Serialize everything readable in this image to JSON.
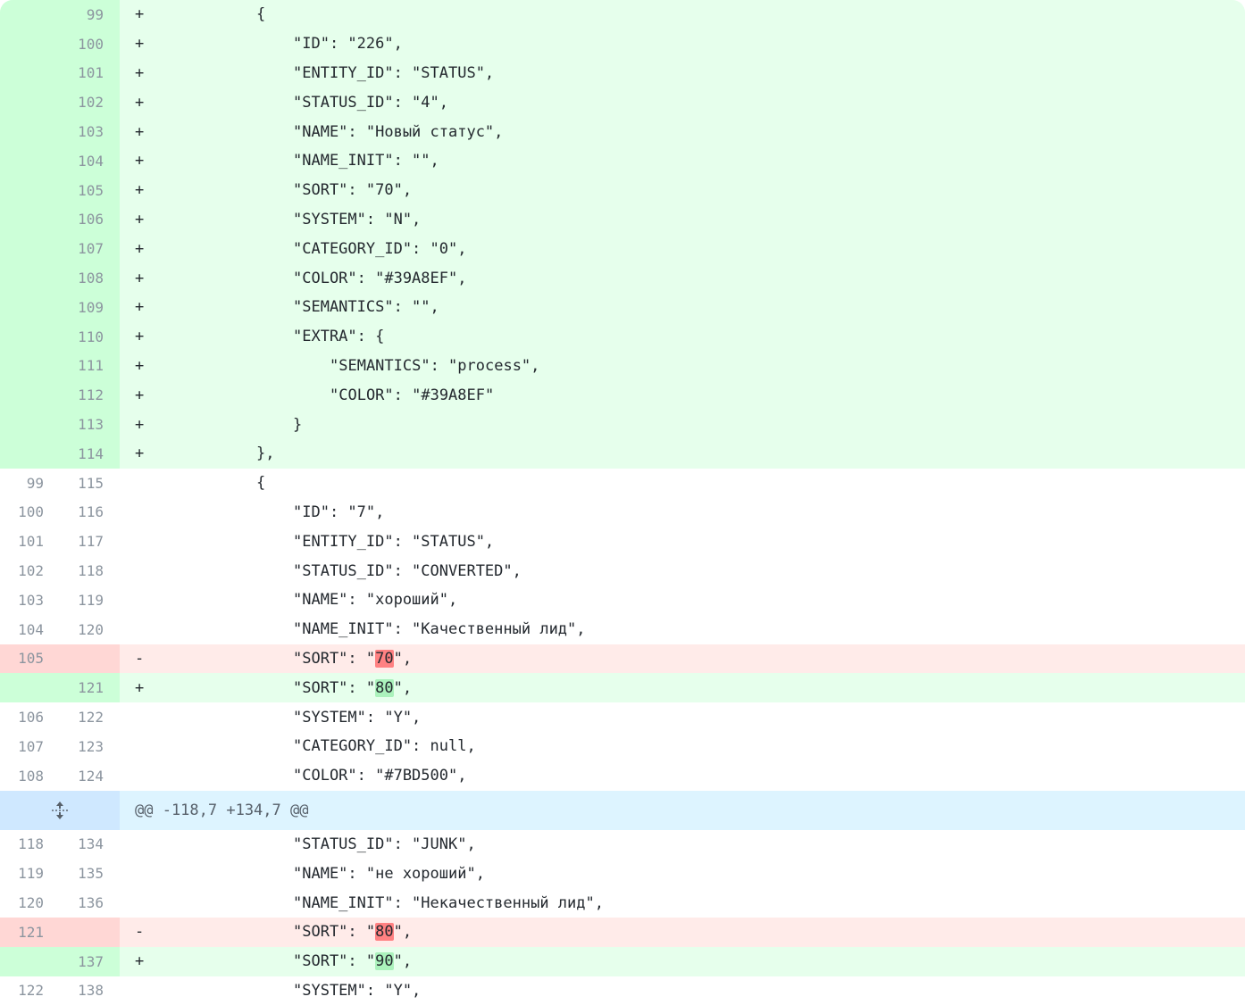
{
  "diff": {
    "block1": [
      {
        "type": "add",
        "old": "",
        "new": "99",
        "sign": "+",
        "indent": 6,
        "pre": "{",
        "hl": "",
        "post": ""
      },
      {
        "type": "add",
        "old": "",
        "new": "100",
        "sign": "+",
        "indent": 8,
        "pre": "\"ID\": \"226\",",
        "hl": "",
        "post": ""
      },
      {
        "type": "add",
        "old": "",
        "new": "101",
        "sign": "+",
        "indent": 8,
        "pre": "\"ENTITY_ID\": \"STATUS\",",
        "hl": "",
        "post": ""
      },
      {
        "type": "add",
        "old": "",
        "new": "102",
        "sign": "+",
        "indent": 8,
        "pre": "\"STATUS_ID\": \"4\",",
        "hl": "",
        "post": ""
      },
      {
        "type": "add",
        "old": "",
        "new": "103",
        "sign": "+",
        "indent": 8,
        "pre": "\"NAME\": \"Новый статус\",",
        "hl": "",
        "post": ""
      },
      {
        "type": "add",
        "old": "",
        "new": "104",
        "sign": "+",
        "indent": 8,
        "pre": "\"NAME_INIT\": \"\",",
        "hl": "",
        "post": ""
      },
      {
        "type": "add",
        "old": "",
        "new": "105",
        "sign": "+",
        "indent": 8,
        "pre": "\"SORT\": \"70\",",
        "hl": "",
        "post": ""
      },
      {
        "type": "add",
        "old": "",
        "new": "106",
        "sign": "+",
        "indent": 8,
        "pre": "\"SYSTEM\": \"N\",",
        "hl": "",
        "post": ""
      },
      {
        "type": "add",
        "old": "",
        "new": "107",
        "sign": "+",
        "indent": 8,
        "pre": "\"CATEGORY_ID\": \"0\",",
        "hl": "",
        "post": ""
      },
      {
        "type": "add",
        "old": "",
        "new": "108",
        "sign": "+",
        "indent": 8,
        "pre": "\"COLOR\": \"#39A8EF\",",
        "hl": "",
        "post": ""
      },
      {
        "type": "add",
        "old": "",
        "new": "109",
        "sign": "+",
        "indent": 8,
        "pre": "\"SEMANTICS\": \"\",",
        "hl": "",
        "post": ""
      },
      {
        "type": "add",
        "old": "",
        "new": "110",
        "sign": "+",
        "indent": 8,
        "pre": "\"EXTRA\": {",
        "hl": "",
        "post": ""
      },
      {
        "type": "add",
        "old": "",
        "new": "111",
        "sign": "+",
        "indent": 10,
        "pre": "\"SEMANTICS\": \"process\",",
        "hl": "",
        "post": ""
      },
      {
        "type": "add",
        "old": "",
        "new": "112",
        "sign": "+",
        "indent": 10,
        "pre": "\"COLOR\": \"#39A8EF\"",
        "hl": "",
        "post": ""
      },
      {
        "type": "add",
        "old": "",
        "new": "113",
        "sign": "+",
        "indent": 8,
        "pre": "}",
        "hl": "",
        "post": ""
      },
      {
        "type": "add",
        "old": "",
        "new": "114",
        "sign": "+",
        "indent": 6,
        "pre": "},",
        "hl": "",
        "post": ""
      },
      {
        "type": "ctx",
        "old": "99",
        "new": "115",
        "sign": "",
        "indent": 6,
        "pre": "{",
        "hl": "",
        "post": ""
      },
      {
        "type": "ctx",
        "old": "100",
        "new": "116",
        "sign": "",
        "indent": 8,
        "pre": "\"ID\": \"7\",",
        "hl": "",
        "post": ""
      },
      {
        "type": "ctx",
        "old": "101",
        "new": "117",
        "sign": "",
        "indent": 8,
        "pre": "\"ENTITY_ID\": \"STATUS\",",
        "hl": "",
        "post": ""
      },
      {
        "type": "ctx",
        "old": "102",
        "new": "118",
        "sign": "",
        "indent": 8,
        "pre": "\"STATUS_ID\": \"CONVERTED\",",
        "hl": "",
        "post": ""
      },
      {
        "type": "ctx",
        "old": "103",
        "new": "119",
        "sign": "",
        "indent": 8,
        "pre": "\"NAME\": \"хороший\",",
        "hl": "",
        "post": ""
      },
      {
        "type": "ctx",
        "old": "104",
        "new": "120",
        "sign": "",
        "indent": 8,
        "pre": "\"NAME_INIT\": \"Качественный лид\",",
        "hl": "",
        "post": ""
      },
      {
        "type": "del",
        "old": "105",
        "new": "",
        "sign": "-",
        "indent": 8,
        "pre": "\"SORT\": \"",
        "hl": "70",
        "post": "\","
      },
      {
        "type": "add",
        "old": "",
        "new": "121",
        "sign": "+",
        "indent": 8,
        "pre": "\"SORT\": \"",
        "hl": "80",
        "post": "\","
      },
      {
        "type": "ctx",
        "old": "106",
        "new": "122",
        "sign": "",
        "indent": 8,
        "pre": "\"SYSTEM\": \"Y\",",
        "hl": "",
        "post": ""
      },
      {
        "type": "ctx",
        "old": "107",
        "new": "123",
        "sign": "",
        "indent": 8,
        "pre": "\"CATEGORY_ID\": null,",
        "hl": "",
        "post": ""
      },
      {
        "type": "ctx",
        "old": "108",
        "new": "124",
        "sign": "",
        "indent": 8,
        "pre": "\"COLOR\": \"#7BD500\",",
        "hl": "",
        "post": ""
      }
    ],
    "hunk": {
      "icon": "expand-icon",
      "text": "@@ -118,7 +134,7 @@"
    },
    "block2": [
      {
        "type": "ctx",
        "old": "118",
        "new": "134",
        "sign": "",
        "indent": 8,
        "pre": "\"STATUS_ID\": \"JUNK\",",
        "hl": "",
        "post": ""
      },
      {
        "type": "ctx",
        "old": "119",
        "new": "135",
        "sign": "",
        "indent": 8,
        "pre": "\"NAME\": \"не хороший\",",
        "hl": "",
        "post": ""
      },
      {
        "type": "ctx",
        "old": "120",
        "new": "136",
        "sign": "",
        "indent": 8,
        "pre": "\"NAME_INIT\": \"Некачественный лид\",",
        "hl": "",
        "post": ""
      },
      {
        "type": "del",
        "old": "121",
        "new": "",
        "sign": "-",
        "indent": 8,
        "pre": "\"SORT\": \"",
        "hl": "80",
        "post": "\","
      },
      {
        "type": "add",
        "old": "",
        "new": "137",
        "sign": "+",
        "indent": 8,
        "pre": "\"SORT\": \"",
        "hl": "90",
        "post": "\","
      },
      {
        "type": "ctx",
        "old": "122",
        "new": "138",
        "sign": "",
        "indent": 8,
        "pre": "\"SYSTEM\": \"Y\",",
        "hl": "",
        "post": ""
      }
    ],
    "colors": {
      "added_bg": "#e6ffec",
      "added_gutter": "#ccffd8",
      "deleted_bg": "#ffebe9",
      "deleted_gutter": "#ffd7d5",
      "added_highlight": "#abf2bc",
      "deleted_highlight": "#ff8182",
      "hunk_bg": "#ddf4ff"
    }
  }
}
